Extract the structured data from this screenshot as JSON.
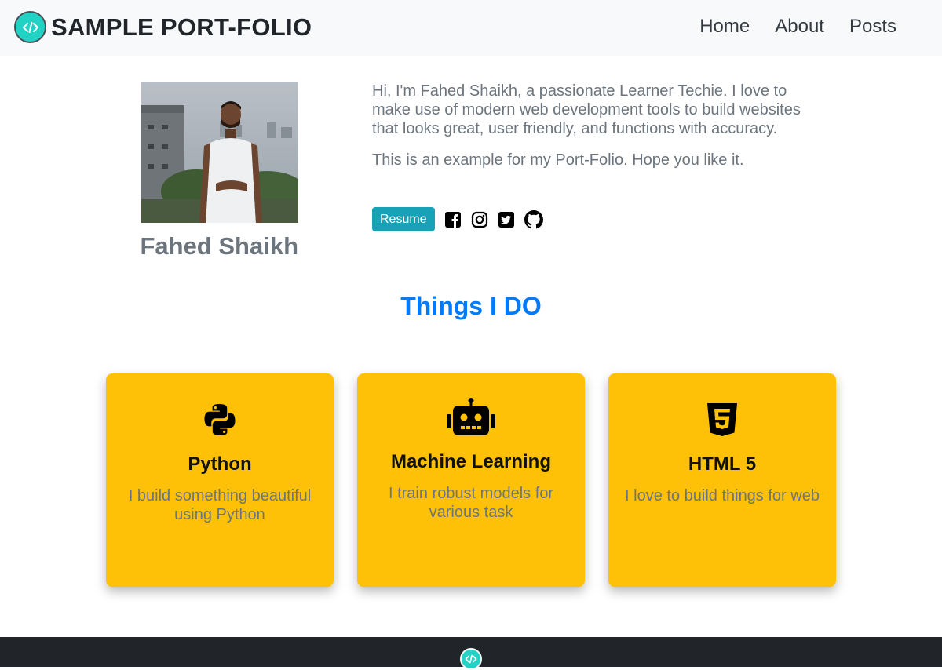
{
  "navbar": {
    "brand": "SAMPLE PORT-FOLIO",
    "logo_icon": "code-icon",
    "links": [
      "Home",
      "About",
      "Posts"
    ]
  },
  "profile": {
    "name": "Fahed Shaikh",
    "bio": [
      "Hi, I'm Fahed Shaikh, a passionate Learner Techie. I love to make use of modern web development tools to build websites that looks great, user friendly, and functions with accuracy.",
      "This is an example for my Port-Folio. Hope you like it."
    ],
    "resume_label": "Resume",
    "social_icons": [
      "facebook-icon",
      "instagram-icon",
      "twitter-icon",
      "github-icon"
    ]
  },
  "things": {
    "title": "Things I DO",
    "cards": [
      {
        "icon": "python-icon",
        "title": "Python",
        "text": "I build something beautiful using Python"
      },
      {
        "icon": "robot-icon",
        "title": "Machine Learning",
        "text": "I train robust models for various task"
      },
      {
        "icon": "html5-icon",
        "title": "HTML 5",
        "text": "I love to build things for web"
      }
    ]
  },
  "colors": {
    "accent": "#007bff",
    "card_bg": "#ffc107",
    "button": "#17a2b8",
    "footer": "#212529",
    "logo": "#22d3c5"
  }
}
